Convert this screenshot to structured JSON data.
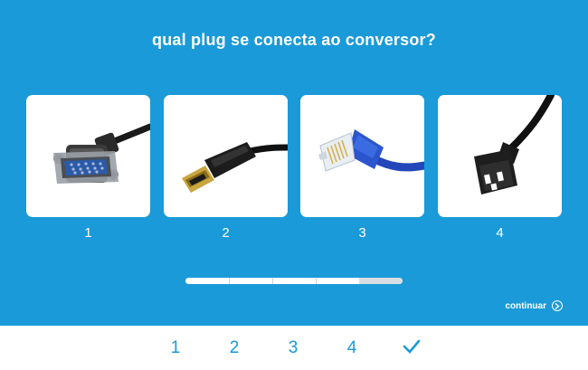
{
  "question": "qual plug se conecta ao conversor?",
  "options": [
    {
      "number": "1",
      "image": "vga-cable-plug"
    },
    {
      "number": "2",
      "image": "hdmi-cable-plug"
    },
    {
      "number": "3",
      "image": "rj45-ethernet-cable-plug"
    },
    {
      "number": "4",
      "image": "iec-power-cable-plug"
    }
  ],
  "progress": {
    "fraction": 0.8,
    "segments": 5
  },
  "continue_label": "continuar",
  "footer": {
    "items": [
      "1",
      "2",
      "3",
      "4"
    ],
    "confirm_icon": "checkmark-icon"
  },
  "colors": {
    "background": "#1a9ad8",
    "accent": "#1a9ad8",
    "text": "#ffffff"
  }
}
